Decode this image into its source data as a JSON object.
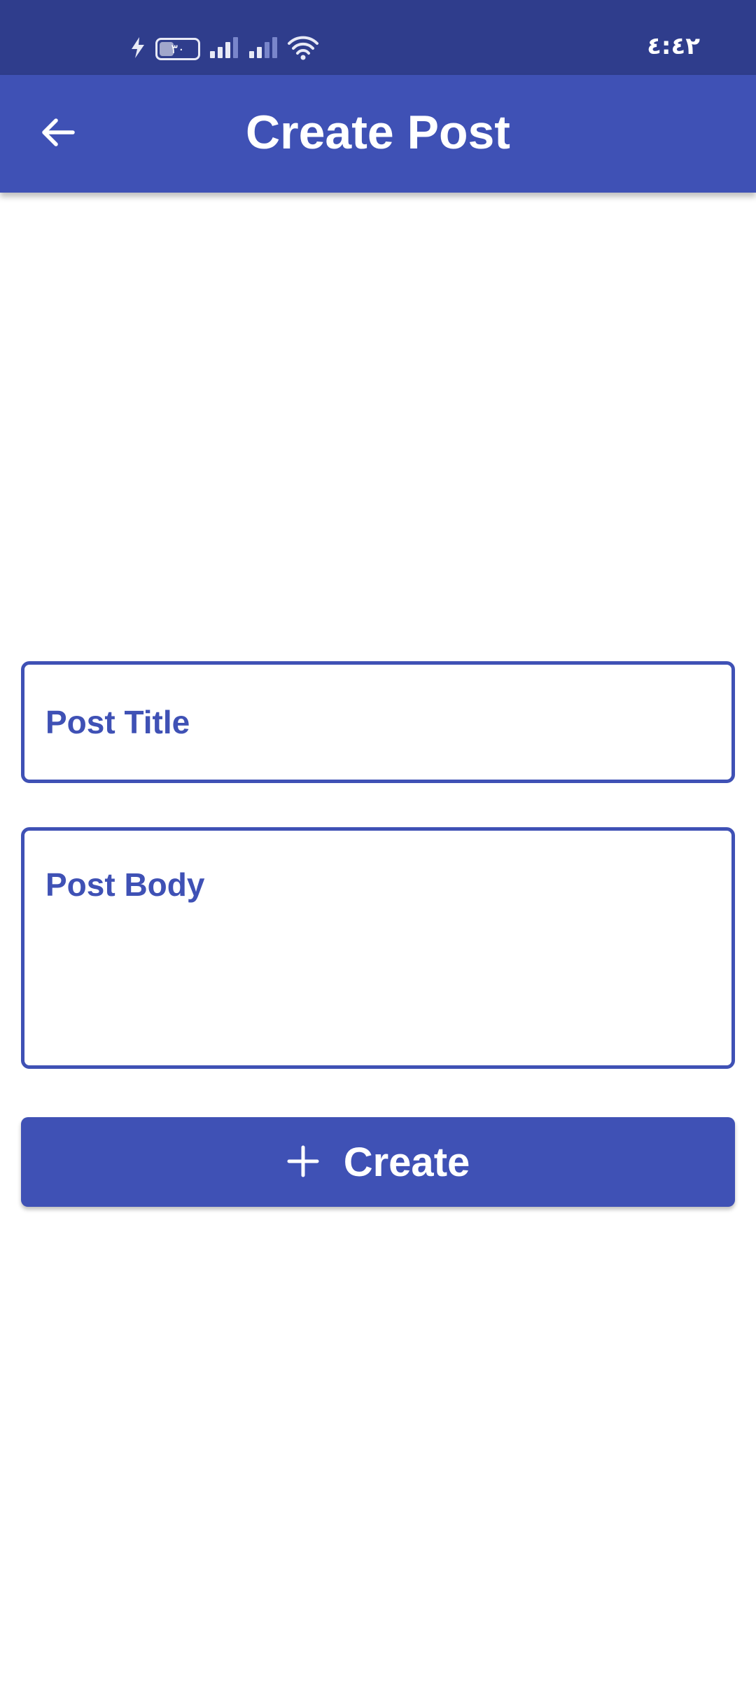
{
  "status_bar": {
    "time": "٤:٤٢",
    "battery_level": "٣٠",
    "icons": [
      "charging-bolt-icon",
      "battery-icon",
      "signal-bars-icon",
      "signal-bars-icon",
      "wifi-icon"
    ]
  },
  "app_bar": {
    "title": "Create Post",
    "back_icon": "arrow-left-icon"
  },
  "form": {
    "title_placeholder": "Post Title",
    "title_value": "",
    "body_placeholder": "Post Body",
    "body_value": ""
  },
  "actions": {
    "create_label": "Create",
    "create_icon": "plus-icon"
  },
  "colors": {
    "status_bar": "#2f3d8c",
    "primary": "#3f51b5",
    "background": "#ffffff",
    "on_primary": "#ffffff"
  }
}
